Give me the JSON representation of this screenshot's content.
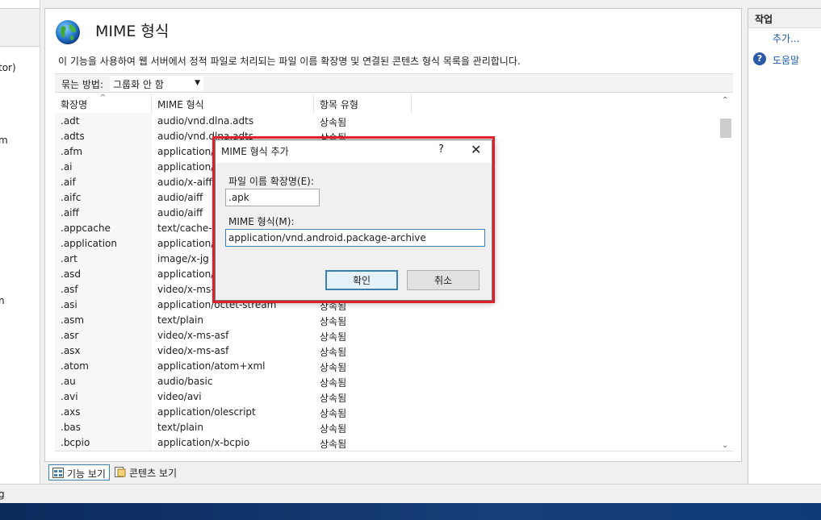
{
  "left_pane": {
    "fragments": [
      "tor)",
      "m",
      "n"
    ]
  },
  "main": {
    "title": "MIME 형식",
    "description": "이 기능을 사용하여 웹 서버에서 정적 파일로 처리되는 파일 이름 확장명 및 연결된 콘텐츠 형식 목록을 관리합니다.",
    "group_by_label": "묶는 방법:",
    "group_by_value": "그룹화 안 함",
    "columns": [
      "확장명",
      "MIME 형식",
      "항목 유형"
    ],
    "rows": [
      [
        ".adt",
        "audio/vnd.dlna.adts",
        "상속됨"
      ],
      [
        ".adts",
        "audio/vnd.dlna.adts",
        "상속됨"
      ],
      [
        ".afm",
        "application/o",
        ""
      ],
      [
        ".ai",
        "application/p",
        ""
      ],
      [
        ".aif",
        "audio/x-aiff",
        ""
      ],
      [
        ".aifc",
        "audio/aiff",
        ""
      ],
      [
        ".aiff",
        "audio/aiff",
        ""
      ],
      [
        ".appcache",
        "text/cache-m",
        ""
      ],
      [
        ".application",
        "application/x",
        ""
      ],
      [
        ".art",
        "image/x-jg",
        ""
      ],
      [
        ".asd",
        "application/o",
        ""
      ],
      [
        ".asf",
        "video/x-ms-a",
        ""
      ],
      [
        ".asi",
        "application/octet-stream",
        "상속됨"
      ],
      [
        ".asm",
        "text/plain",
        "상속됨"
      ],
      [
        ".asr",
        "video/x-ms-asf",
        "상속됨"
      ],
      [
        ".asx",
        "video/x-ms-asf",
        "상속됨"
      ],
      [
        ".atom",
        "application/atom+xml",
        "상속됨"
      ],
      [
        ".au",
        "audio/basic",
        "상속됨"
      ],
      [
        ".avi",
        "video/avi",
        "상속됨"
      ],
      [
        ".axs",
        "application/olescript",
        "상속됨"
      ],
      [
        ".bas",
        "text/plain",
        "상속됨"
      ],
      [
        ".bcpio",
        "application/x-bcpio",
        "상속됨"
      ]
    ]
  },
  "view_tabs": [
    "기능 보기",
    "콘텐츠 보기"
  ],
  "actions": {
    "title": "작업",
    "add": "추가...",
    "help": "도움말"
  },
  "status": {
    "text": "g"
  },
  "dialog": {
    "title": "MIME 형식 추가",
    "help_glyph": "?",
    "close_glyph": "✕",
    "ext_label": "파일 이름 확장명(E):",
    "ext_value": ".apk",
    "mime_label": "MIME 형식(M):",
    "mime_value": "application/vnd.android.package-archive",
    "ok": "확인",
    "cancel": "취소"
  },
  "colors": {
    "highlight": "#e0202a",
    "accent": "#3c7fb1",
    "link": "#1c5fa8"
  }
}
